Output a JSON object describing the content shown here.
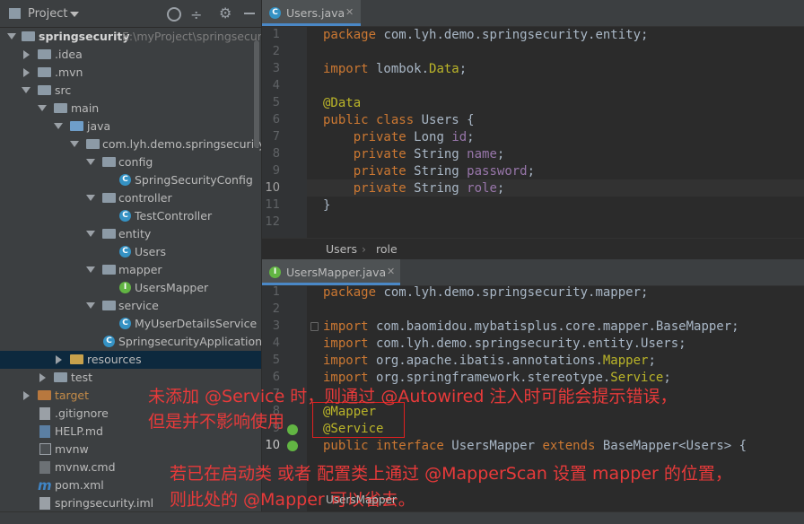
{
  "project_panel": {
    "title": "Project",
    "tree": [
      {
        "label": "springsecurity",
        "path": "E:\\myProject\\springsecurity"
      },
      {
        "label": ".idea"
      },
      {
        "label": ".mvn"
      },
      {
        "label": "src"
      },
      {
        "label": "main"
      },
      {
        "label": "java"
      },
      {
        "label": "com.lyh.demo.springsecurity"
      },
      {
        "label": "config"
      },
      {
        "label": "SpringSecurityConfig"
      },
      {
        "label": "controller"
      },
      {
        "label": "TestController"
      },
      {
        "label": "entity"
      },
      {
        "label": "Users"
      },
      {
        "label": "mapper"
      },
      {
        "label": "UsersMapper"
      },
      {
        "label": "service"
      },
      {
        "label": "MyUserDetailsService"
      },
      {
        "label": "SpringsecurityApplication"
      },
      {
        "label": "resources"
      },
      {
        "label": "test"
      },
      {
        "label": "target"
      },
      {
        "label": ".gitignore"
      },
      {
        "label": "HELP.md"
      },
      {
        "label": "mvnw"
      },
      {
        "label": "mvnw.cmd"
      },
      {
        "label": "pom.xml"
      },
      {
        "label": "springsecurity.iml"
      }
    ]
  },
  "editor1": {
    "tab": "Users.java",
    "line_numbers": [
      "1",
      "2",
      "3",
      "4",
      "5",
      "6",
      "7",
      "8",
      "9",
      "10",
      "11",
      "12"
    ],
    "breadcrumb": [
      "Users",
      "role"
    ]
  },
  "editor2": {
    "tab": "UsersMapper.java",
    "line_numbers": [
      "1",
      "2",
      "3",
      "4",
      "5",
      "6",
      "7",
      "8",
      "9",
      "10"
    ],
    "breadcrumb": [
      "UsersMapper"
    ]
  },
  "annotations": {
    "note1_line1": "未添加 @Service 时，则通过 @Autowired 注入时可能会提示错误，",
    "note1_line2": "但是并不影响使用",
    "note2_line1": "若已在启动类 或者 配置类上通过 @MapperScan 设置 mapper 的位置，",
    "note2_line2": "则此处的 @Mapper 可以省去。"
  },
  "colors": {
    "keyword": "#cc7832",
    "annotation": "#bbb529",
    "field": "#9876aa",
    "note": "#e83a3a"
  }
}
